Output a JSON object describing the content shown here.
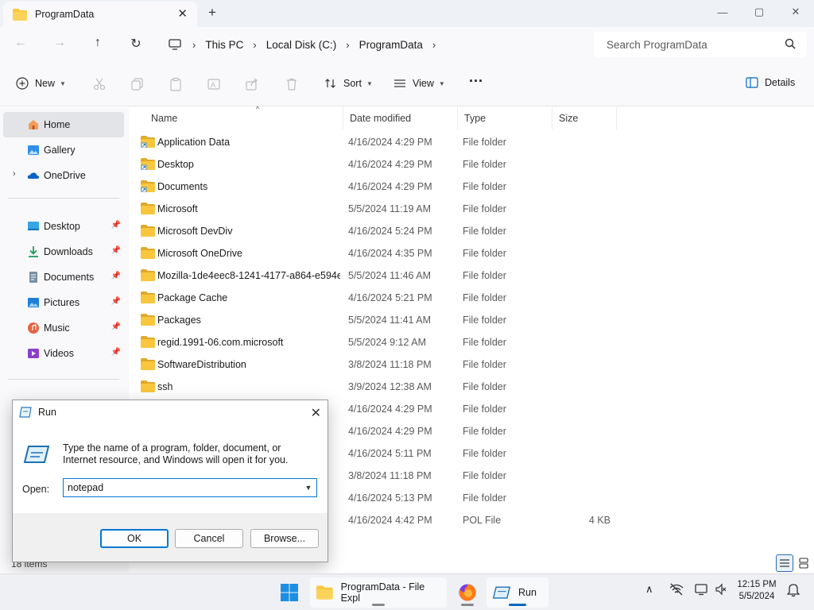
{
  "window": {
    "tab_title": "ProgramData",
    "controls": {
      "minimize": "—",
      "maximize": "▢",
      "close": "✕"
    }
  },
  "address": {
    "crumbs": [
      "This PC",
      "Local Disk (C:)",
      "ProgramData"
    ],
    "search_placeholder": "Search ProgramData"
  },
  "commands": {
    "new_label": "New",
    "sort_label": "Sort",
    "view_label": "View",
    "more_label": "···",
    "details_label": "Details"
  },
  "sidebar": {
    "items": [
      {
        "label": "Home",
        "icon": "home-icon",
        "active": true
      },
      {
        "label": "Gallery",
        "icon": "gallery-icon"
      },
      {
        "label": "OneDrive",
        "icon": "onedrive-icon",
        "expandable": true
      },
      {
        "label": "Desktop",
        "icon": "desktop-icon",
        "pinned": true
      },
      {
        "label": "Downloads",
        "icon": "downloads-icon",
        "pinned": true
      },
      {
        "label": "Documents",
        "icon": "documents-icon",
        "pinned": true
      },
      {
        "label": "Pictures",
        "icon": "pictures-icon",
        "pinned": true
      },
      {
        "label": "Music",
        "icon": "music-icon",
        "pinned": true
      },
      {
        "label": "Videos",
        "icon": "videos-icon",
        "pinned": true
      }
    ]
  },
  "filelist": {
    "columns": [
      "Name",
      "Date modified",
      "Type",
      "Size"
    ],
    "rows": [
      {
        "name": "Application Data",
        "date": "4/16/2024 4:29 PM",
        "type": "File folder",
        "size": "",
        "shortcut": true
      },
      {
        "name": "Desktop",
        "date": "4/16/2024 4:29 PM",
        "type": "File folder",
        "size": "",
        "shortcut": true
      },
      {
        "name": "Documents",
        "date": "4/16/2024 4:29 PM",
        "type": "File folder",
        "size": "",
        "shortcut": true
      },
      {
        "name": "Microsoft",
        "date": "5/5/2024 11:19 AM",
        "type": "File folder",
        "size": ""
      },
      {
        "name": "Microsoft DevDiv",
        "date": "4/16/2024 5:24 PM",
        "type": "File folder",
        "size": ""
      },
      {
        "name": "Microsoft OneDrive",
        "date": "4/16/2024 4:35 PM",
        "type": "File folder",
        "size": ""
      },
      {
        "name": "Mozilla-1de4eec8-1241-4177-a864-e594e...",
        "date": "5/5/2024 11:46 AM",
        "type": "File folder",
        "size": ""
      },
      {
        "name": "Package Cache",
        "date": "4/16/2024 5:21 PM",
        "type": "File folder",
        "size": ""
      },
      {
        "name": "Packages",
        "date": "5/5/2024 11:41 AM",
        "type": "File folder",
        "size": ""
      },
      {
        "name": "regid.1991-06.com.microsoft",
        "date": "5/5/2024 9:12 AM",
        "type": "File folder",
        "size": ""
      },
      {
        "name": "SoftwareDistribution",
        "date": "3/8/2024 11:18 PM",
        "type": "File folder",
        "size": ""
      },
      {
        "name": "ssh",
        "date": "3/9/2024 12:38 AM",
        "type": "File folder",
        "size": ""
      },
      {
        "name": "",
        "date": "4/16/2024 4:29 PM",
        "type": "File folder",
        "size": ""
      },
      {
        "name": "",
        "date": "4/16/2024 4:29 PM",
        "type": "File folder",
        "size": ""
      },
      {
        "name": "",
        "date": "4/16/2024 5:11 PM",
        "type": "File folder",
        "size": ""
      },
      {
        "name": "",
        "date": "3/8/2024 11:18 PM",
        "type": "File folder",
        "size": ""
      },
      {
        "name": "",
        "date": "4/16/2024 5:13 PM",
        "type": "File folder",
        "size": ""
      },
      {
        "name": "",
        "date": "4/16/2024 4:42 PM",
        "type": "POL File",
        "size": "4 KB"
      }
    ],
    "status": "18 items"
  },
  "run_dialog": {
    "title": "Run",
    "message": "Type the name of a program, folder, document, or Internet resource, and Windows will open it for you.",
    "open_label": "Open:",
    "command_value": "notepad",
    "ok_label": "OK",
    "cancel_label": "Cancel",
    "browse_label": "Browse..."
  },
  "taskbar": {
    "explorer_label": "ProgramData - File Expl",
    "run_label": "Run",
    "time": "12:15 PM",
    "date": "5/5/2024"
  },
  "colors": {
    "accent": "#0078d4",
    "folder": "#f8c73e",
    "folder_dark": "#e1a82a"
  }
}
